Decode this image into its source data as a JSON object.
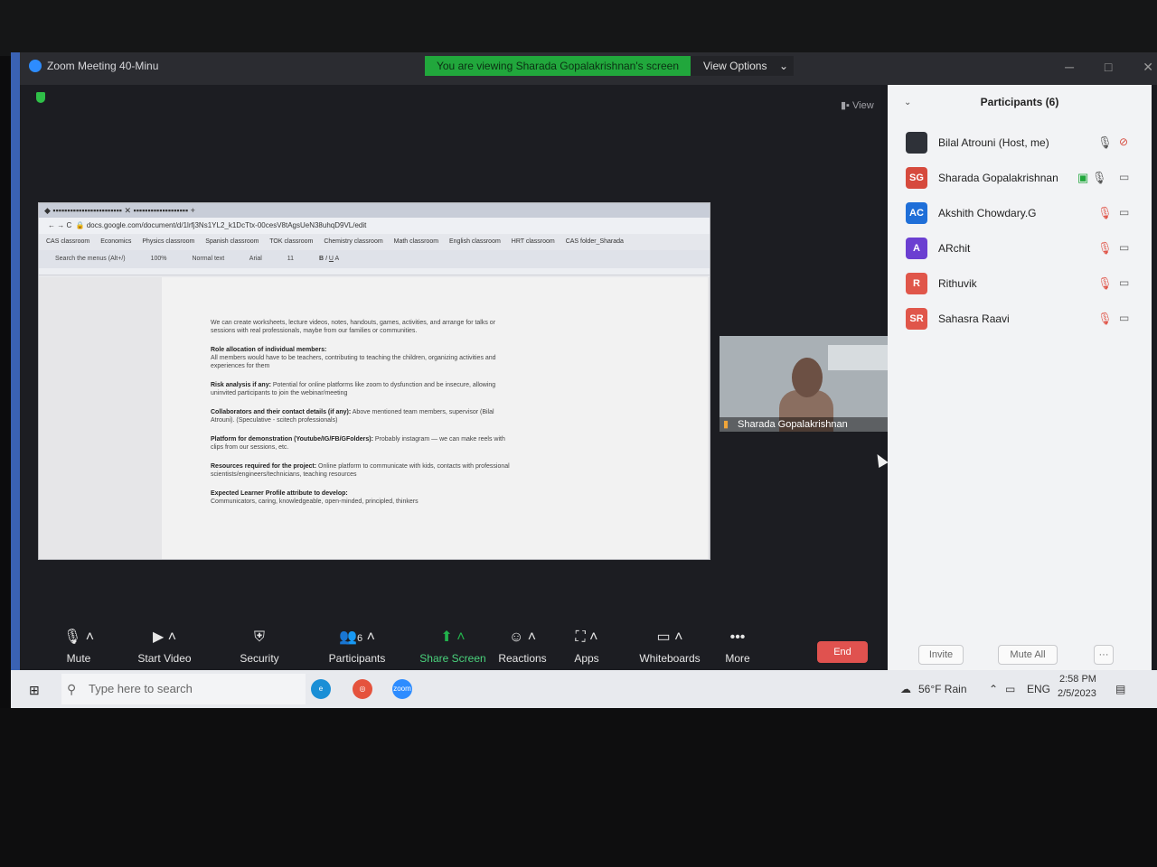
{
  "zoom": {
    "window_title": "Zoom Meeting 40-Minu",
    "viewing_banner": "You are viewing Sharada Gopalakrishnan's screen",
    "view_options": "View Options",
    "view_label": "View",
    "controls": [
      "─",
      "□",
      "✕"
    ]
  },
  "shared_doc": {
    "toolbar_url": "docs.google.com/document/d/1lrfj3Ns1YL2_k1DcTtx-00cesV8tAgsUeN38uhqD9VL/edit",
    "bookmarks": [
      "CAS classroom",
      "Economics",
      "Physics classroom",
      "Spanish classroom",
      "TOK classroom",
      "Chemistry classroom",
      "Math classroom",
      "English classroom",
      "HRT classroom",
      "CAS folder_Sharada"
    ],
    "menu_search": "Search the menus (Alt+/)",
    "zoom": "100%",
    "style": "Normal text",
    "font": "Arial",
    "size": "11",
    "paragraphs": [
      {
        "text": "We can create worksheets, lecture videos, notes, handouts, games, activities, and arrange for talks or sessions with real professionals, maybe from our families or communities."
      },
      {
        "heading": "Role allocation of individual members:",
        "text": "All members would have to be teachers, contributing to teaching the children, organizing activities and experiences for them"
      },
      {
        "heading": "Risk analysis if any:",
        "text": "Potential for online platforms like zoom to dysfunction and be insecure, allowing uninvited participants to join the webinar/meeting"
      },
      {
        "heading": "Collaborators and their contact details (if any):",
        "text": "Above mentioned team members, supervisor (Bilal Atrouni). (Speculative - scitech professionals)"
      },
      {
        "heading": "Platform for demonstration (Youtube/IG/FB/GFolders):",
        "text": "Probably instagram — we can make reels with clips from our sessions, etc."
      },
      {
        "heading": "Resources required for the project:",
        "text": "Online platform to communicate with kids, contacts with professional scientists/engineers/technicians, teaching resources"
      },
      {
        "heading": "Expected Learner Profile attribute to develop:",
        "text": "Communicators, caring, knowledgeable, open-minded, principled, thinkers"
      }
    ]
  },
  "video_tile": {
    "name": "Sharada Gopalakrishnan"
  },
  "toolbar": {
    "mute": "Mute",
    "start_video": "Start Video",
    "security": "Security",
    "participants": "Participants",
    "participants_count": "6",
    "share_screen": "Share Screen",
    "reactions": "Reactions",
    "apps": "Apps",
    "whiteboards": "Whiteboards",
    "more": "More",
    "end": "End"
  },
  "participants_panel": {
    "header": "Participants (6)",
    "list": [
      {
        "initials": "",
        "name": "Bilal Atrouni (Host, me)",
        "color": "#2e3138"
      },
      {
        "initials": "SG",
        "name": "Sharada Gopalakrishnan",
        "color": "#d64a3d"
      },
      {
        "initials": "AC",
        "name": "Akshith Chowdary.G",
        "color": "#1f6fd8"
      },
      {
        "initials": "A",
        "name": "ARchit",
        "color": "#6b3fd1"
      },
      {
        "initials": "R",
        "name": "Rithuvik",
        "color": "#e0564a"
      },
      {
        "initials": "SR",
        "name": "Sahasra Raavi",
        "color": "#e0564a"
      }
    ],
    "invite": "Invite",
    "mute_all": "Mute All",
    "more": "···"
  },
  "taskbar": {
    "search_placeholder": "Type here to search",
    "weather": "56°F  Rain",
    "lang": "ENG",
    "time": "2:58 PM",
    "date": "2/5/2023",
    "zoom_app": "zoom"
  }
}
